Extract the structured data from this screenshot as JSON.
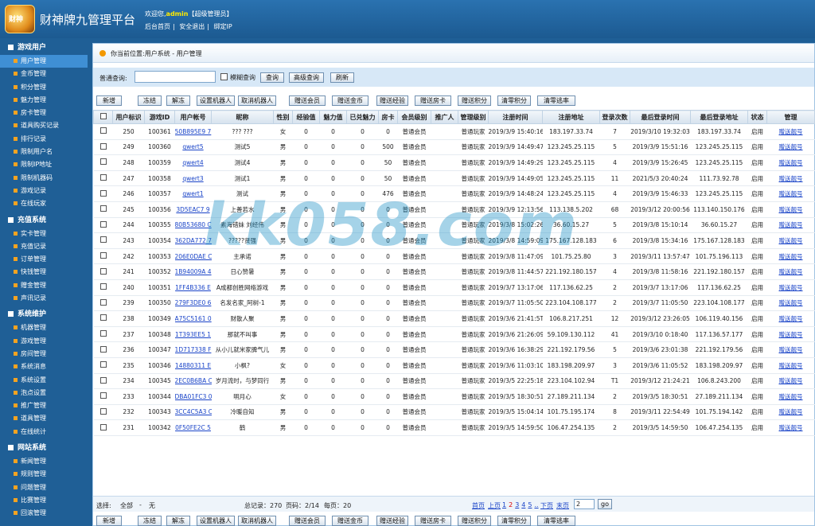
{
  "header": {
    "logo_text": "财神",
    "title": "财神牌九管理平台",
    "welcome_prefix": "欢迎您,",
    "username": "admin",
    "role": "【超级管理员】",
    "links": [
      "后台首页",
      "安全退出",
      "绑定IP"
    ]
  },
  "sidebar": [
    {
      "title": "游戏用户",
      "items": [
        "用户管理",
        "金币管理",
        "积分管理",
        "魅力管理",
        "房卡管理",
        "道具购买记录",
        "排行记录",
        "限制用户名",
        "限制IP地址",
        "限制机器码",
        "游戏记录",
        "在线玩家"
      ]
    },
    {
      "title": "充值系统",
      "items": [
        "实卡管理",
        "充值记录",
        "订单管理",
        "快钱管理",
        "赠金管理",
        "声讯记录"
      ]
    },
    {
      "title": "系统维护",
      "items": [
        "机器管理",
        "游戏管理",
        "房间管理",
        "系统消息",
        "系统设置",
        "泡点设置",
        "推广管理",
        "道具管理",
        "在线统计"
      ]
    },
    {
      "title": "网站系统",
      "items": [
        "新闻管理",
        "规则管理",
        "问题管理",
        "比赛管理",
        "回滚管理"
      ]
    }
  ],
  "active_item": "用户管理",
  "breadcrumb": "你当前位置:用户系统 - 用户管理",
  "search": {
    "label": "普通查询:",
    "value": "",
    "fuzzy_label": "模糊查询",
    "buttons": [
      "查询",
      "高级查询",
      "刷新"
    ]
  },
  "toolbar": [
    "新增",
    "冻结",
    "解冻",
    "设置机器人",
    "取消机器人",
    "赠送会员",
    "赠送金币",
    "赠送经验",
    "赠送房卡",
    "赠送积分",
    "清零积分",
    "清零逃率"
  ],
  "table": {
    "headers": [
      "用户标识",
      "游戏ID",
      "用户帐号",
      "昵称",
      "性别",
      "经验值",
      "魅力值",
      "已兑魅力",
      "房卡",
      "会员级别",
      "推广人",
      "管理级别",
      "注册时间",
      "注册地址",
      "登录次数",
      "最后登录时间",
      "最后登录地址",
      "状态",
      "管理"
    ],
    "rows": [
      [
        "250",
        "100361",
        "50B895E9 7",
        "??? ???",
        "女",
        "0",
        "0",
        "0",
        "0",
        "普通会员",
        "",
        "普通玩家",
        "2019/3/9 15:40:16",
        "183.197.33.74",
        "7",
        "2019/3/10 19:32:03",
        "183.197.33.74",
        "启用",
        "赠送靓号"
      ],
      [
        "249",
        "100360",
        "qwert5",
        "测试5",
        "男",
        "0",
        "0",
        "0",
        "500",
        "普通会员",
        "",
        "普通玩家",
        "2019/3/9 14:49:47",
        "123.245.25.115",
        "5",
        "2019/3/9 15:51:16",
        "123.245.25.115",
        "启用",
        "赠送靓号"
      ],
      [
        "248",
        "100359",
        "qwert4",
        "测试4",
        "男",
        "0",
        "0",
        "0",
        "50",
        "普通会员",
        "",
        "普通玩家",
        "2019/3/9 14:49:29",
        "123.245.25.115",
        "4",
        "2019/3/9 15:26:45",
        "123.245.25.115",
        "启用",
        "赠送靓号"
      ],
      [
        "247",
        "100358",
        "qwert3",
        "测试1",
        "男",
        "0",
        "0",
        "0",
        "50",
        "普通会员",
        "",
        "普通玩家",
        "2019/3/9 14:49:05",
        "123.245.25.115",
        "11",
        "2021/5/3 20:40:24",
        "111.73.92.78",
        "启用",
        "赠送靓号"
      ],
      [
        "246",
        "100357",
        "qwert1",
        "测试",
        "男",
        "0",
        "0",
        "0",
        "476",
        "普通会员",
        "",
        "普通玩家",
        "2019/3/9 14:48:24",
        "123.245.25.115",
        "4",
        "2019/3/9 15:46:33",
        "123.245.25.115",
        "启用",
        "赠送靓号"
      ],
      [
        "245",
        "100356",
        "3D5EAC7 9",
        "上善若水",
        "男",
        "0",
        "0",
        "0",
        "0",
        "普通会员",
        "",
        "普通玩家",
        "2019/3/9 12:13:56",
        "113.138.5.202",
        "68",
        "2019/3/12 20:00:56",
        "113.140.150.176",
        "启用",
        "赠送靓号"
      ],
      [
        "244",
        "100355",
        "80B53680 C",
        "素海错妹 刘经伟",
        "男",
        "0",
        "0",
        "0",
        "0",
        "普通会员",
        "",
        "普通玩家",
        "2019/3/8 15:02:26",
        "36.60.15.27",
        "5",
        "2019/3/8 15:10:14",
        "36.60.15.27",
        "启用",
        "赠送靓号"
      ],
      [
        "243",
        "100354",
        "362DA772 7",
        "?????贤强",
        "男",
        "0",
        "0",
        "0",
        "0",
        "普通会员",
        "",
        "普通玩家",
        "2019/3/8 14:59:09",
        "175.167.128.183",
        "6",
        "2019/3/8 15:34:16",
        "175.167.128.183",
        "启用",
        "赠送靓号"
      ],
      [
        "242",
        "100353",
        "206E0DAE C",
        "主承诺",
        "男",
        "0",
        "0",
        "0",
        "0",
        "普通会员",
        "",
        "普通玩家",
        "2019/3/8 11:47:09",
        "101.75.25.80",
        "3",
        "2019/3/11 13:57:47",
        "101.75.196.113",
        "启用",
        "赠送靓号"
      ],
      [
        "241",
        "100352",
        "1B94009A 4",
        "日心赞暑",
        "男",
        "0",
        "0",
        "0",
        "0",
        "普通会员",
        "",
        "普通玩家",
        "2019/3/8 11:44:57",
        "221.192.180.157",
        "4",
        "2019/3/8 11:58:16",
        "221.192.180.157",
        "启用",
        "赠送靓号"
      ],
      [
        "240",
        "100351",
        "1FF4B336 E",
        "A成都创胜网络游戏",
        "男",
        "0",
        "0",
        "0",
        "0",
        "普通会员",
        "",
        "普通玩家",
        "2019/3/7 13:17:06",
        "117.136.62.25",
        "2",
        "2019/3/7 13:17:06",
        "117.136.62.25",
        "启用",
        "赠送靓号"
      ],
      [
        "239",
        "100350",
        "279F3DE0 6",
        "名发名家_阿树-1",
        "男",
        "0",
        "0",
        "0",
        "0",
        "普通会员",
        "",
        "普通玩家",
        "2019/3/7 11:05:50",
        "223.104.108.177",
        "2",
        "2019/3/7 11:05:50",
        "223.104.108.177",
        "启用",
        "赠送靓号"
      ],
      [
        "238",
        "100349",
        "A75C5161 0",
        "财散人聚",
        "男",
        "0",
        "0",
        "0",
        "0",
        "普通会员",
        "",
        "普通玩家",
        "2019/3/6 21:41:5T",
        "106.8.217.251",
        "12",
        "2019/3/12 23:26:05",
        "106.119.40.156",
        "启用",
        "赠送靓号"
      ],
      [
        "237",
        "100348",
        "1T393EE5 1",
        "那就不叫事",
        "男",
        "0",
        "0",
        "0",
        "0",
        "普通会员",
        "",
        "普通玩家",
        "2019/3/6 21:26:09",
        "59.109.130.112",
        "41",
        "2019/3/10 0:18:40",
        "117.136.57.177",
        "启用",
        "赠送靓号"
      ],
      [
        "236",
        "100347",
        "1D717338 F",
        "从小儿就米家脾气儿",
        "男",
        "0",
        "0",
        "0",
        "0",
        "普通会员",
        "",
        "普通玩家",
        "2019/3/6 16:38:29",
        "221.192.179.56",
        "5",
        "2019/3/6 23:01:38",
        "221.192.179.56",
        "启用",
        "赠送靓号"
      ],
      [
        "235",
        "100346",
        "14880311 E",
        "小枫?",
        "女",
        "0",
        "0",
        "0",
        "0",
        "普通会员",
        "",
        "普通玩家",
        "2019/3/6 11:03:10",
        "183.198.209.97",
        "3",
        "2019/3/6 11:05:52",
        "183.198.209.97",
        "启用",
        "赠送靓号"
      ],
      [
        "234",
        "100345",
        "2EC0B6BA C",
        "岁月流时，与梦同行",
        "男",
        "0",
        "0",
        "0",
        "0",
        "普通会员",
        "",
        "普通玩家",
        "2019/3/5 22:25:18",
        "223.104.102.94",
        "T1",
        "2019/3/12 21:24:21",
        "106.8.243.200",
        "启用",
        "赠送靓号"
      ],
      [
        "233",
        "100344",
        "DBA01FC3 0",
        "明月心",
        "女",
        "0",
        "0",
        "0",
        "0",
        "普通会员",
        "",
        "普通玩家",
        "2019/3/5 18:30:51",
        "27.189.211.134",
        "2",
        "2019/3/5 18:30:51",
        "27.189.211.134",
        "启用",
        "赠送靓号"
      ],
      [
        "232",
        "100343",
        "3CC4C5A3 C",
        "冷暖自知",
        "男",
        "0",
        "0",
        "0",
        "0",
        "普通会员",
        "",
        "普通玩家",
        "2019/3/5 15:04:14",
        "101.75.195.174",
        "8",
        "2019/3/11 22:54:49",
        "101.75.194.142",
        "启用",
        "赠送靓号"
      ],
      [
        "231",
        "100342",
        "0F50FE2C 5",
        "鹤",
        "男",
        "0",
        "0",
        "0",
        "0",
        "普通会员",
        "",
        "普通玩家",
        "2019/3/5 14:59:50",
        "106.47.254.135",
        "2",
        "2019/3/5 14:59:50",
        "106.47.254.135",
        "启用",
        "赠送靓号"
      ]
    ]
  },
  "pager": {
    "select_label": "选择:",
    "select_all": "全部",
    "dash": "-",
    "select_none": "无",
    "total": "总记录：270",
    "page": "页码：2/14",
    "per_page": "每页：20",
    "first": "首页",
    "prev": "上页",
    "pages": [
      "1",
      "2",
      "3",
      "4",
      "5",
      ".."
    ],
    "current_page": "2",
    "next": "下页",
    "last": "末页",
    "goto_value": "2",
    "go": "go"
  },
  "watermark": "kk058.com"
}
